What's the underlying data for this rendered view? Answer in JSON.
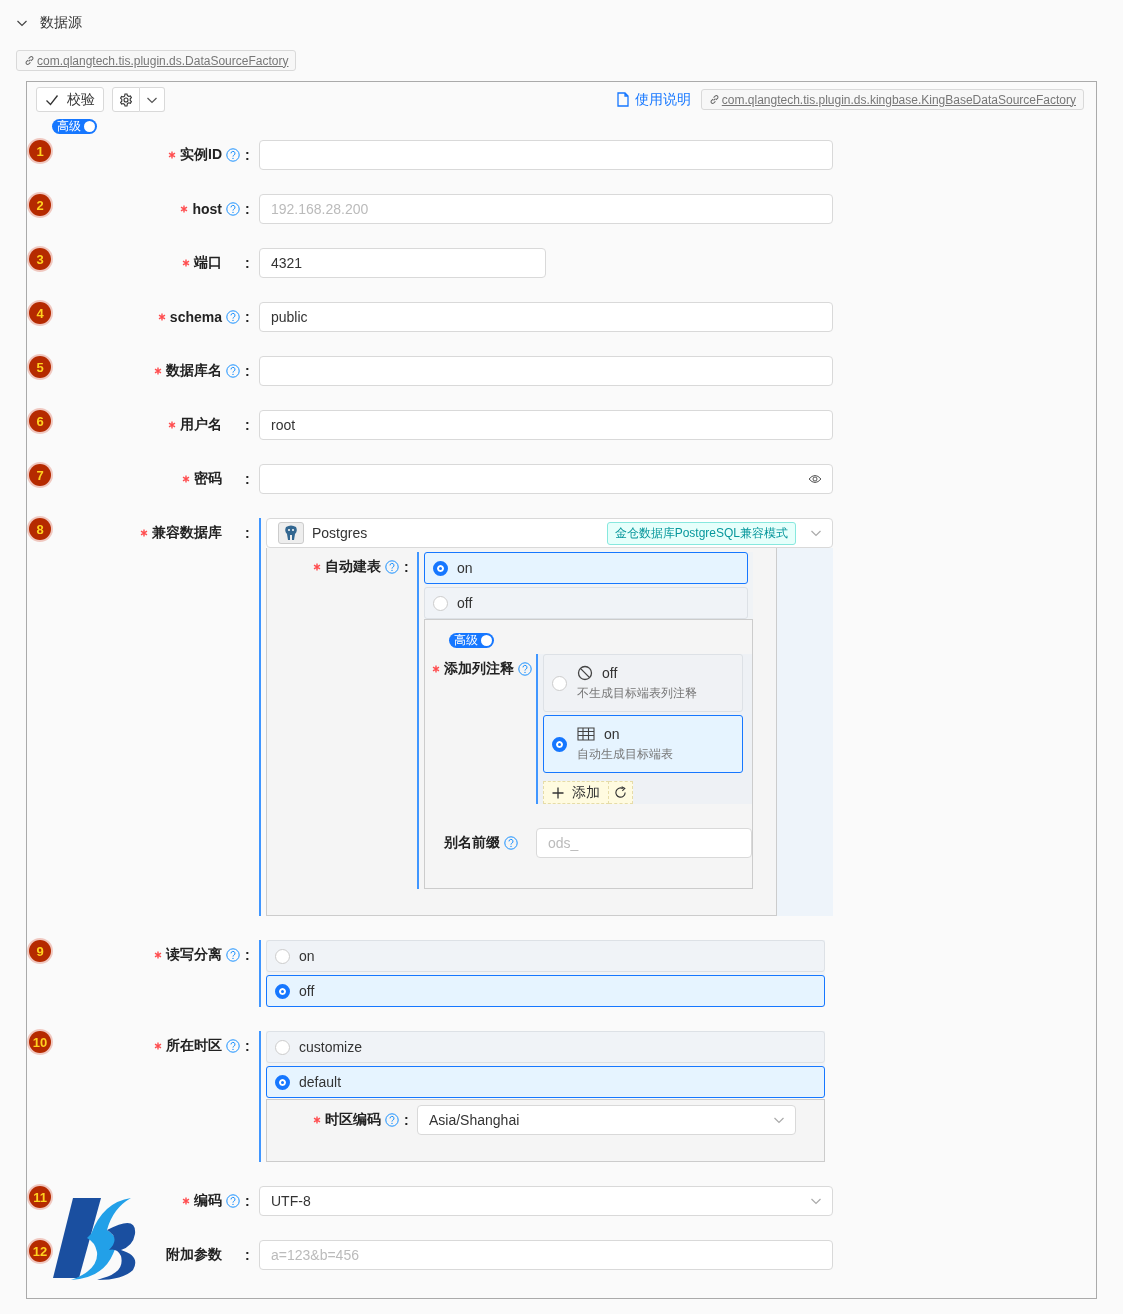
{
  "section": {
    "title": "数据源",
    "expanded": true
  },
  "class_link": "com.qlangtech.tis.plugin.ds.DataSourceFactory",
  "toolbar": {
    "validate_button": "校验",
    "manual_link": "使用说明",
    "impl_link": "com.qlangtech.tis.plugin.ds.kingbase.KingBaseDataSourceFactory"
  },
  "advanced_toggle": {
    "label": "高级",
    "on": true
  },
  "fields": [
    {
      "number": "1",
      "label": "实例ID",
      "required": true,
      "help": true,
      "separator": ":",
      "kind": "text"
    },
    {
      "number": "2",
      "label": "host",
      "required": true,
      "help": true,
      "separator": ":",
      "kind": "text",
      "placeholder": "192.168.28.200"
    },
    {
      "number": "3",
      "label": "端口",
      "required": true,
      "help": false,
      "separator": ":",
      "kind": "number",
      "value": "4321"
    },
    {
      "number": "4",
      "label": "schema",
      "required": true,
      "help": true,
      "separator": ":",
      "kind": "text",
      "value": "public"
    },
    {
      "number": "5",
      "label": "数据库名",
      "required": true,
      "help": true,
      "separator": ":",
      "kind": "text"
    },
    {
      "number": "6",
      "label": "用户名",
      "required": true,
      "help": false,
      "separator": ":",
      "kind": "text",
      "value": "root"
    },
    {
      "number": "7",
      "label": "密码",
      "required": true,
      "help": false,
      "separator": ":",
      "kind": "password"
    },
    {
      "number": "8",
      "label": "兼容数据库",
      "required": true,
      "help": false,
      "separator": ":",
      "kind": "plugin-select",
      "value": "Postgres",
      "tag": "金仓数据库PostgreSQL兼容模式",
      "subform": {
        "fields": [
          {
            "label": "自动建表",
            "required": true,
            "help": true,
            "separator": ":",
            "kind": "radio",
            "options": [
              {
                "label": "on",
                "selected": true
              },
              {
                "label": "off",
                "selected": false
              }
            ],
            "subform": {
              "advanced_toggle": {
                "label": "高级",
                "on": true
              },
              "fields": [
                {
                  "label": "添加列注释",
                  "required": true,
                  "help": true,
                  "kind": "card-radio",
                  "options": [
                    {
                      "label": "off",
                      "description": "不生成目标端表列注释",
                      "selected": false
                    },
                    {
                      "label": "on",
                      "description": "自动生成目标端表",
                      "selected": true
                    }
                  ],
                  "add_button": "添加"
                },
                {
                  "label": "别名前缀",
                  "required": false,
                  "help": true,
                  "kind": "text",
                  "placeholder": "ods_"
                }
              ]
            }
          }
        ]
      }
    },
    {
      "number": "9",
      "label": "读写分离",
      "required": true,
      "help": true,
      "separator": ":",
      "kind": "radio",
      "options": [
        {
          "label": "on",
          "selected": false
        },
        {
          "label": "off",
          "selected": true
        }
      ]
    },
    {
      "number": "10",
      "label": "所在时区",
      "required": true,
      "help": true,
      "separator": ":",
      "kind": "radio",
      "options": [
        {
          "label": "customize",
          "selected": false
        },
        {
          "label": "default",
          "selected": true
        }
      ],
      "subform": {
        "fields": [
          {
            "label": "时区编码",
            "required": true,
            "help": true,
            "separator": ":",
            "kind": "select",
            "value": "Asia/Shanghai"
          }
        ]
      }
    },
    {
      "number": "11",
      "label": "编码",
      "required": true,
      "help": true,
      "separator": ":",
      "kind": "select",
      "value": "UTF-8"
    },
    {
      "number": "12",
      "label": "附加参数",
      "required": false,
      "help": false,
      "separator": ":",
      "kind": "text",
      "placeholder": "a=123&b=456"
    }
  ]
}
